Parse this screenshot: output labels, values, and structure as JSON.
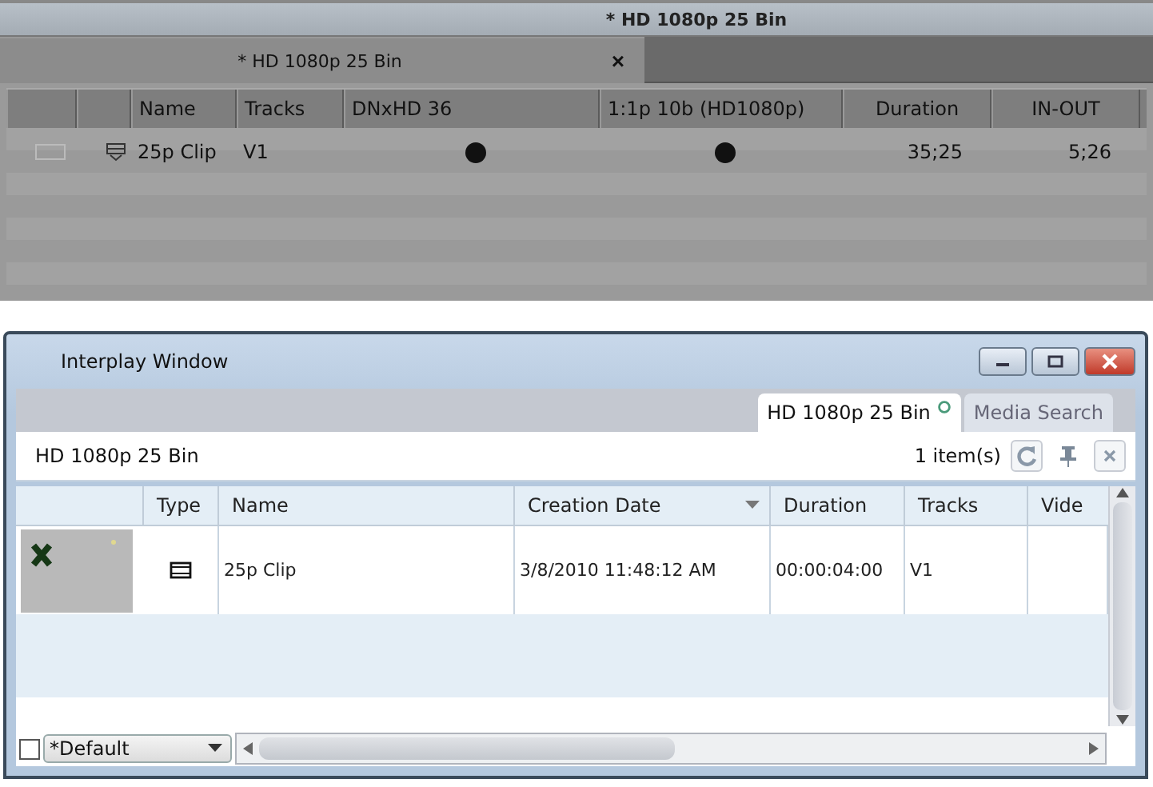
{
  "media_composer_bin": {
    "title": "* HD 1080p 25 Bin",
    "tab": {
      "label": "* HD 1080p 25 Bin",
      "close": "×"
    },
    "columns": [
      "Name",
      "Tracks",
      "DNxHD 36",
      "1:1p 10b (HD1080p)",
      "Duration",
      "IN-OUT"
    ],
    "rows": [
      {
        "name": "25p Clip",
        "tracks": "V1",
        "dnxhd_36": true,
        "full_res": true,
        "duration": "35;25",
        "in_out": "5;26"
      }
    ]
  },
  "interplay_window": {
    "title": "Interplay Window",
    "tabs": [
      {
        "label": "HD 1080p 25 Bin",
        "selected": true
      },
      {
        "label": "Media Search",
        "selected": false
      }
    ],
    "toolbar": {
      "location": "HD 1080p 25 Bin",
      "count": "1 item(s)"
    },
    "columns": [
      "Type",
      "Name",
      "Creation Date",
      "Duration",
      "Tracks",
      "Vide"
    ],
    "rows": [
      {
        "name": "25p Clip",
        "creation_date": "3/8/2010 11:48:12 AM",
        "duration": "00:00:04:00",
        "tracks": "V1",
        "selected": false
      }
    ],
    "view": {
      "checked": false,
      "value": "*Default"
    }
  }
}
